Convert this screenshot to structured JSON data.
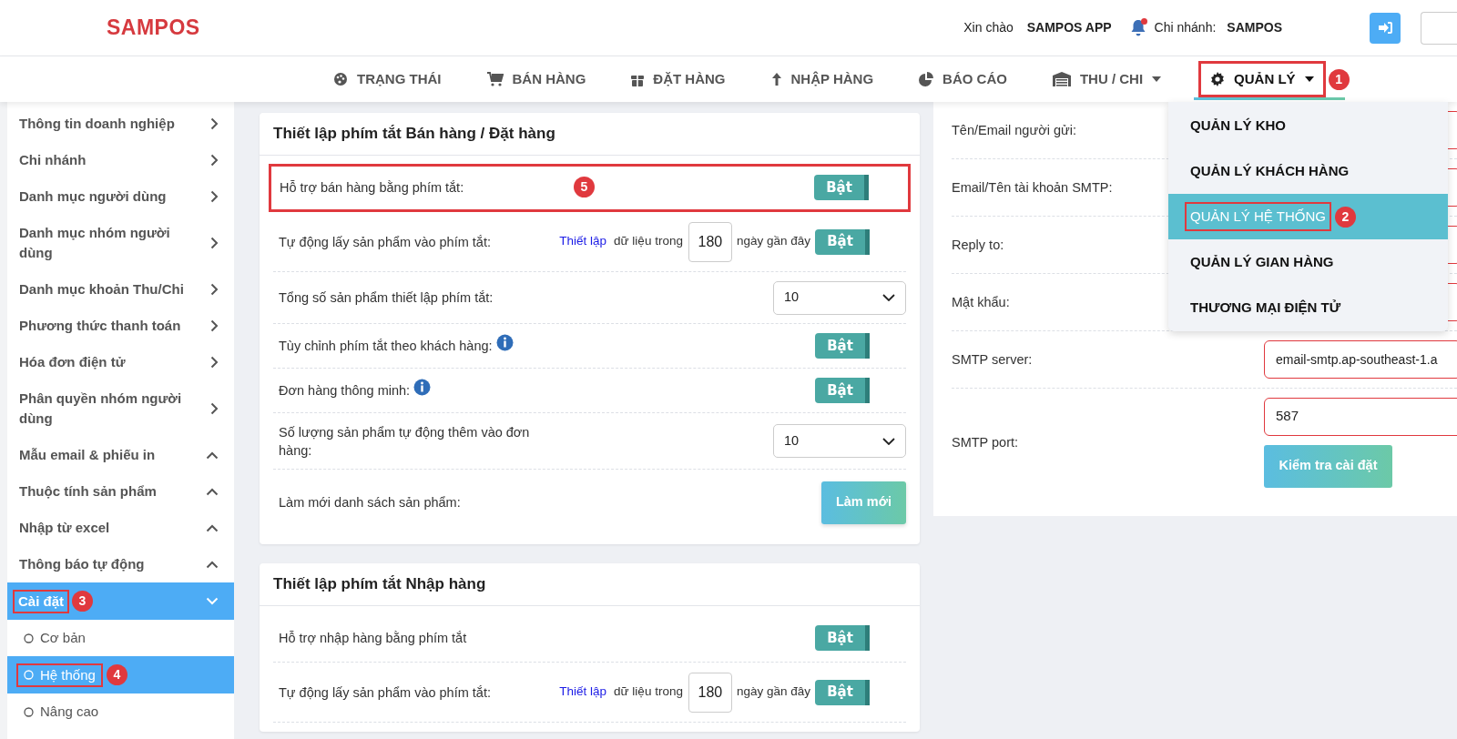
{
  "header": {
    "logo": "SAMPOS",
    "greeting": "Xin chào",
    "user": "SAMPOS APP",
    "branch_label": "Chi nhánh:",
    "branch": "SAMPOS",
    "notification": true
  },
  "nav": [
    {
      "label": "TRẠNG THÁI",
      "selected": false,
      "dropdown": false
    },
    {
      "label": "BÁN HÀNG",
      "selected": false,
      "dropdown": false
    },
    {
      "label": "ĐẶT HÀNG",
      "selected": false,
      "dropdown": false
    },
    {
      "label": "NHẬP HÀNG",
      "selected": false,
      "dropdown": false
    },
    {
      "label": "BÁO CÁO",
      "selected": false,
      "dropdown": false
    },
    {
      "label": "THU / CHI",
      "selected": false,
      "dropdown": true
    },
    {
      "label": "QUẢN LÝ",
      "selected": true,
      "dropdown": true,
      "marker": "1"
    }
  ],
  "dropdown_menu": [
    {
      "label": "QUẢN LÝ KHO",
      "selected": false
    },
    {
      "label": "QUẢN LÝ KHÁCH HÀNG",
      "selected": false
    },
    {
      "label": "QUẢN LÝ HỆ THỐNG",
      "selected": true,
      "marker": "2"
    },
    {
      "label": "QUẢN LÝ GIAN HÀNG",
      "selected": false
    },
    {
      "label": "THƯƠNG MẠI ĐIỆN TỬ",
      "selected": false
    }
  ],
  "sidebar": [
    {
      "label": "Thông tin doanh nghiệp",
      "kind": "right",
      "selected": false
    },
    {
      "label": "Chi nhánh",
      "kind": "right",
      "selected": false
    },
    {
      "label": "Danh mục người dùng",
      "kind": "right",
      "selected": false
    },
    {
      "label": "Danh mục nhóm người dùng",
      "kind": "right",
      "selected": false
    },
    {
      "label": "Danh mục khoản Thu/Chi",
      "kind": "right",
      "selected": false
    },
    {
      "label": "Phương thức thanh toán",
      "kind": "right",
      "selected": false
    },
    {
      "label": "Hóa đơn điện tử",
      "kind": "right",
      "selected": false
    },
    {
      "label": "Phân quyền nhóm người dùng",
      "kind": "right",
      "selected": false
    },
    {
      "label": "Mẫu email & phiếu in",
      "kind": "up",
      "selected": false
    },
    {
      "label": "Thuộc tính sản phẩm",
      "kind": "up",
      "selected": false
    },
    {
      "label": "Nhập từ excel",
      "kind": "up",
      "selected": false
    },
    {
      "label": "Thông báo tự động",
      "kind": "up",
      "selected": false
    },
    {
      "label": "Cài đặt",
      "kind": "down",
      "selected": true,
      "marker": "3",
      "children": [
        {
          "label": "Cơ bản",
          "selected": false
        },
        {
          "label": "Hệ thống",
          "selected": true,
          "marker": "4"
        },
        {
          "label": "Nâng cao",
          "selected": false
        }
      ]
    }
  ],
  "cards": [
    {
      "title": "Thiết lập phím tắt Bán hàng / Đặt hàng",
      "rows": [
        {
          "kind": "toggle",
          "label": "Hỗ trợ bán hàng bằng phím tắt:",
          "toggle": {
            "label": "Bật",
            "on": true
          },
          "marker": "5"
        },
        {
          "kind": "auto",
          "label": "Tự động lấy sản phẩm vào phím tắt:",
          "link": "Thiết lập",
          "before": "dữ liệu trong",
          "value": "180",
          "after": "ngày gần đây",
          "toggle": {
            "label": "Bật",
            "on": true
          }
        },
        {
          "kind": "select",
          "label": "Tổng số sản phẩm thiết lập phím tắt:",
          "value": "10"
        },
        {
          "kind": "toggle",
          "label": "Tùy chỉnh phím tắt theo khách hàng:",
          "info": true,
          "toggle": {
            "label": "Bật",
            "on": true
          }
        },
        {
          "kind": "toggle",
          "label": "Đơn hàng thông minh:",
          "info": true,
          "toggle": {
            "label": "Bật",
            "on": true
          }
        },
        {
          "kind": "select",
          "label": "Số lượng sản phẩm tự động thêm vào đơn hàng:",
          "value": "10"
        },
        {
          "kind": "button",
          "label": "Làm mới danh sách sản phẩm:",
          "button": "Làm mới"
        }
      ]
    },
    {
      "title": "Thiết lập phím tắt Nhập hàng",
      "rows": [
        {
          "kind": "toggle",
          "label": "Hỗ trợ nhập hàng bằng phím tắt",
          "toggle": {
            "label": "Bật",
            "on": true
          }
        },
        {
          "kind": "auto",
          "label": "Tự động lấy sản phẩm vào phím tắt:",
          "link": "Thiết lập",
          "before": "dữ liệu trong",
          "value": "180",
          "after": "ngày gần đây",
          "toggle": {
            "label": "Bật",
            "on": true
          }
        }
      ]
    }
  ],
  "email_settings": {
    "rows": [
      {
        "kind": "field",
        "label": "Tên/Email người gửi:"
      },
      {
        "kind": "field",
        "label": "Email/Tên tài khoản SMTP:"
      },
      {
        "kind": "field",
        "label": "Reply to:"
      },
      {
        "kind": "field",
        "label": "Mật khẩu:"
      },
      {
        "kind": "field",
        "label": "SMTP server:",
        "value": "email-smtp.ap-southeast-1.a"
      },
      {
        "kind": "field_button",
        "label": "SMTP port:",
        "value": "587",
        "button": "Kiểm tra cài đặt"
      }
    ]
  }
}
